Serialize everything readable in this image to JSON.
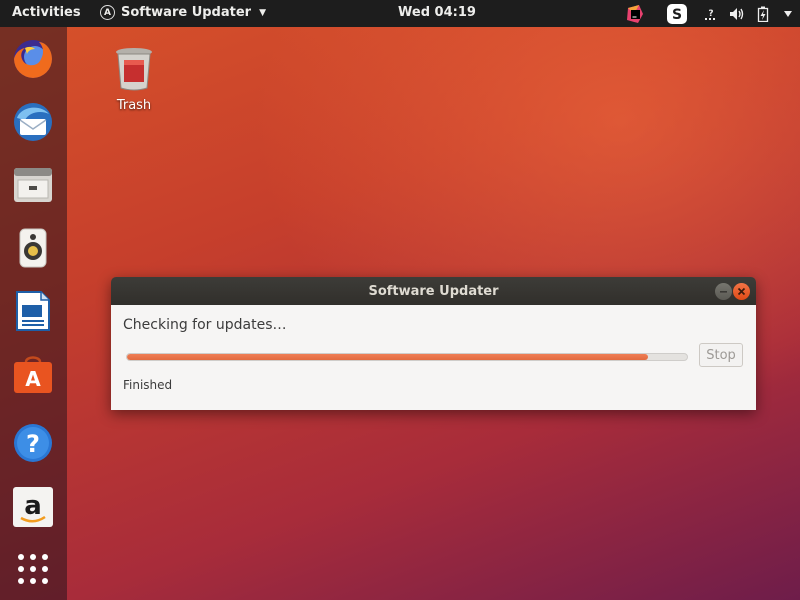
{
  "topbar": {
    "activities": "Activities",
    "app_name": "Software Updater",
    "app_icon": "software-updater-icon",
    "clock": "Wed 04:19",
    "tray": [
      "jetbrains-toolbox-icon",
      "skype-icon",
      "network-unknown-icon",
      "volume-icon",
      "battery-icon",
      "system-menu-caret-icon"
    ]
  },
  "dock": {
    "items": [
      "firefox-icon",
      "thunderbird-icon",
      "files-icon",
      "rhythmbox-icon",
      "libreoffice-writer-icon",
      "ubuntu-software-icon",
      "help-icon",
      "amazon-icon",
      "show-applications-icon"
    ]
  },
  "desktop": {
    "trash_label": "Trash"
  },
  "dialog": {
    "title": "Software Updater",
    "status": "Checking for updates…",
    "progress": 0.93,
    "stop_label": "Stop",
    "detail": "Finished"
  }
}
